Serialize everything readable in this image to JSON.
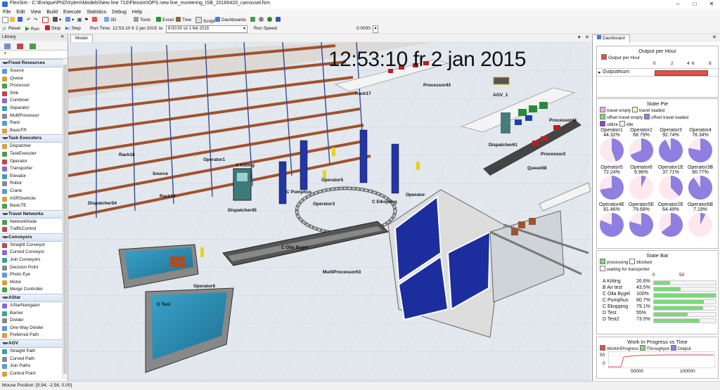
{
  "window": {
    "title": "FlexSim - C:\\Enrique\\PhD\\Xylem\\Models\\New line 710\\Flexsim\\OPS new line_montering_ISB_20160420_carrousel.fsm"
  },
  "menu": [
    "File",
    "Edit",
    "View",
    "Build",
    "Execute",
    "Statistics",
    "Debug",
    "Help"
  ],
  "toolbar1": [
    "3D",
    "Tools",
    "Excel",
    "Tree",
    "Script",
    "Dashboards"
  ],
  "toolbar2": {
    "reset": "Reset",
    "run": "Run",
    "stop": "Stop",
    "step": "Step",
    "run_time_label": "Run Time:",
    "run_time_value": "12:53:10  fr 2 jan 2015",
    "to_label": "to",
    "stop_time_value": "6:00:00  sö 1 feb 2015",
    "run_speed_label": "Run Speed:",
    "run_speed_value": "0.0000",
    "run_speed_fraction": 0.0
  },
  "library": {
    "title": "Library",
    "groups": [
      {
        "name": "Fixed Resources",
        "items": [
          "Source",
          "Queue",
          "Processor",
          "Sink",
          "Combiner",
          "Separator",
          "MultiProcessor",
          "Rack",
          "BasicFR"
        ]
      },
      {
        "name": "Task Executers",
        "items": [
          "Dispatcher",
          "TaskExecuter",
          "Operator",
          "Transporter",
          "Elevator",
          "Robot",
          "Crane",
          "ASRSvehicle",
          "BasicTE"
        ]
      },
      {
        "name": "Travel Networks",
        "items": [
          "NetworkNode",
          "TrafficControl"
        ]
      },
      {
        "name": "Conveyors",
        "items": [
          "Straight Conveyor",
          "Curved Conveyor",
          "Join Conveyors",
          "Decision Point",
          "Photo Eye",
          "Motor",
          "Merge Controller"
        ]
      },
      {
        "name": "AStar",
        "items": [
          "AStarNavigator",
          "Barrier",
          "Divider",
          "One-Way Divider",
          "Preferred Path"
        ]
      },
      {
        "name": "AGV",
        "items": [
          "Straight Path",
          "Curved Path",
          "Join Paths",
          "Control Point"
        ]
      }
    ]
  },
  "model": {
    "tab": "Model",
    "clock": "12:53:10  fr 2 jan 2015",
    "labels": [
      "Rack17",
      "Processor43",
      "AGV_1",
      "Processor44",
      "Dispatcher61",
      "Processor2",
      "Queue58",
      "Rack18",
      "Source",
      "Rack19",
      "Dispatcher54",
      "Operator1",
      "A Kitting",
      "Dispatcher45",
      "C Pumphus",
      "Operator5",
      "Operator3",
      "C Elkopling",
      "Operator",
      "C Olia Bygel",
      "MultiProcessor63",
      "Operator6",
      "D Test"
    ]
  },
  "dashboard": {
    "tab": "Dashboard",
    "output_per_hour": {
      "title": "Output per Hour",
      "legend": "Output per Hour",
      "ticks": [
        "0",
        "2",
        "4",
        "6",
        "8"
      ],
      "row_label": "Output#sum",
      "value": 7.4,
      "max": 8
    },
    "state_pie": {
      "title": "State Pie",
      "legend": [
        "travel empty",
        "travel loaded",
        "offset travel empty",
        "offset travel loaded",
        "utilize",
        "idle"
      ],
      "colors": {
        "travel_empty": "#f2a8e8",
        "travel_loaded": "#f5f0b0",
        "offset_empty": "#7fd67f",
        "offset_loaded": "#8f7fe0",
        "utilize": "#8a3fc8",
        "idle": "#fde8ee"
      },
      "operators": [
        {
          "name": "Operator1",
          "pct": "44.32%",
          "value": 44.32
        },
        {
          "name": "Operator2",
          "pct": "68.79%",
          "value": 68.79
        },
        {
          "name": "Operator3",
          "pct": "92.74%",
          "value": 92.74
        },
        {
          "name": "Operator4",
          "pct": "78.34%",
          "value": 78.34
        },
        {
          "name": "Operator5",
          "pct": "72.24%",
          "value": 72.24
        },
        {
          "name": "Operator6",
          "pct": "6.96%",
          "value": 6.96
        },
        {
          "name": "Operator1E",
          "pct": "37.71%",
          "value": 37.71
        },
        {
          "name": "Operator3B",
          "pct": "90.77%",
          "value": 90.77
        },
        {
          "name": "Operator4E",
          "pct": "81.46%",
          "value": 81.46
        },
        {
          "name": "Operator5E",
          "pct": "79.68%",
          "value": 79.68
        },
        {
          "name": "Operator2E",
          "pct": "64.49%",
          "value": 64.49
        },
        {
          "name": "Operator6B",
          "pct": "7.19%",
          "value": 7.19
        }
      ]
    },
    "state_bar": {
      "title": "State Bar",
      "legend": [
        "processing",
        "blocked",
        "waiting for transporter"
      ],
      "ticks": [
        "0",
        "50"
      ],
      "rows": [
        {
          "name": "A Kitting",
          "pct": "26.6%",
          "value": 26.6
        },
        {
          "name": "B Air test",
          "pct": "43.5%",
          "value": 43.5
        },
        {
          "name": "C Olia Bygel",
          "pct": "100%",
          "value": 100
        },
        {
          "name": "C Pumphus",
          "pct": "80.7%",
          "value": 80.7
        },
        {
          "name": "C Ekopping",
          "pct": "79.1%",
          "value": 79.1
        },
        {
          "name": "D Test",
          "pct": "55%",
          "value": 55
        },
        {
          "name": "D Test2",
          "pct": "73.5%",
          "value": 73.5
        }
      ]
    },
    "wip": {
      "title": "Work In Progress vs Time",
      "legend": [
        "WorkInProgress",
        "Throughput",
        "Output"
      ],
      "y_ticks": [
        "50",
        "0"
      ],
      "x_ticks": [
        "50000",
        "100000"
      ]
    }
  },
  "status": {
    "mouse_position": "Mouse Position: [9.94, -2.56, 0.00]"
  }
}
